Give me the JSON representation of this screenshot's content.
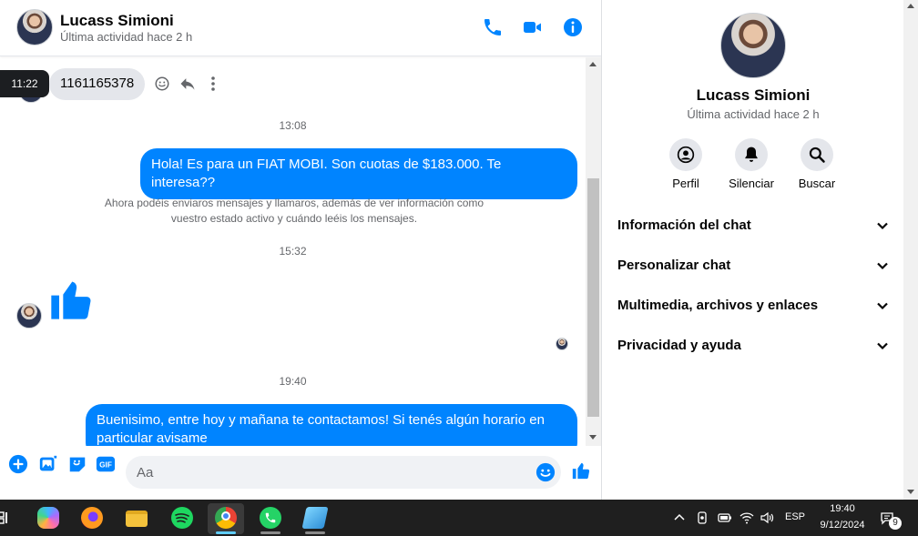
{
  "header": {
    "name": "Lucass Simioni",
    "status": "Última actividad hace 2 h"
  },
  "tooltip": {
    "time": "11:22"
  },
  "messages": {
    "received_1": "1161165378",
    "time_1": "13:08",
    "sent_1": "Hola! Es para un FIAT MOBI. Son cuotas de $183.000. Te interesa??",
    "system_1": "Ahora podéis enviaros mensajes y llamaros, además de ver información como vuestro estado activo y cuándo leéis los mensajes.",
    "time_2": "15:32",
    "time_3": "19:40",
    "sent_2": "Buenisimo, entre hoy y mañana te contactamos! Si tenés algún horario en particular avisame"
  },
  "composer": {
    "placeholder": "Aa"
  },
  "info": {
    "name": "Lucass Simioni",
    "status": "Última actividad hace 2 h",
    "actions": [
      {
        "label": "Perfil"
      },
      {
        "label": "Silenciar"
      },
      {
        "label": "Buscar"
      }
    ],
    "sections": [
      {
        "label": "Información del chat"
      },
      {
        "label": "Personalizar chat"
      },
      {
        "label": "Multimedia, archivos y enlaces"
      },
      {
        "label": "Privacidad y ayuda"
      }
    ]
  },
  "taskbar": {
    "lang": "ESP",
    "time": "19:40",
    "date": "9/12/2024",
    "notifications": "9"
  },
  "colors": {
    "accent": "#0084ff",
    "bubble_in": "#e4e6eb",
    "taskbar": "#1f1f1f"
  }
}
